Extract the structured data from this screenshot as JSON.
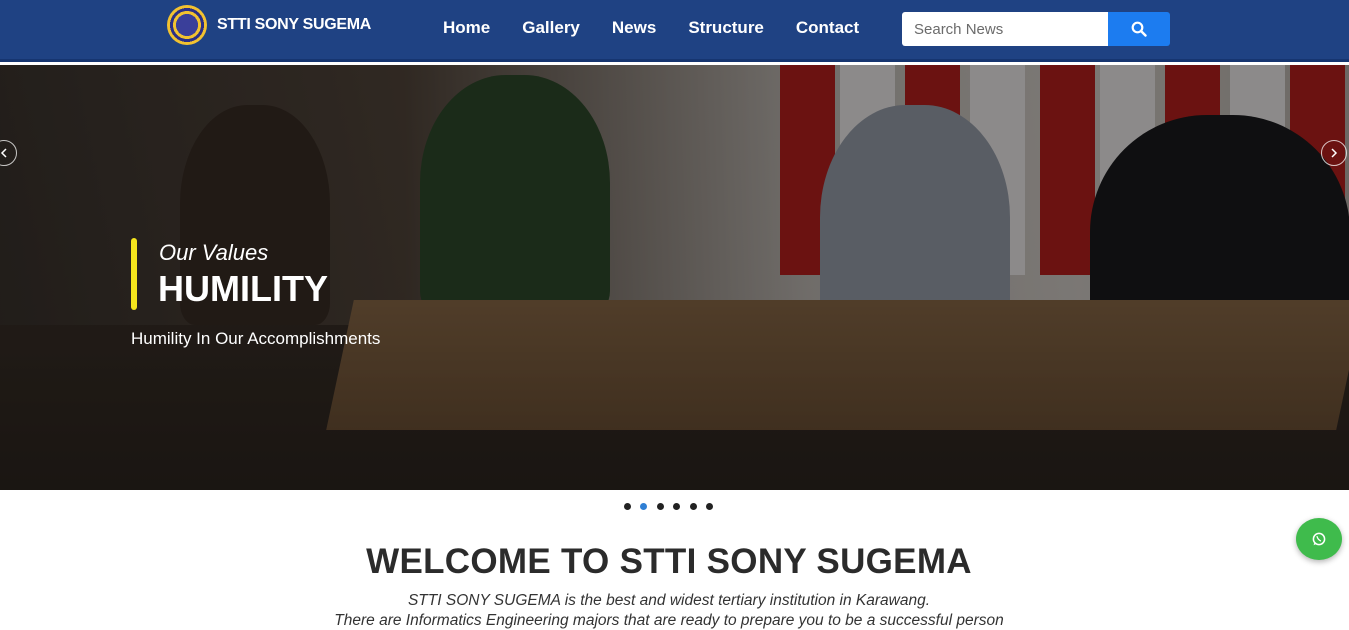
{
  "brand": {
    "name": "STTI SONY SUGEMA"
  },
  "nav": {
    "items": [
      "Home",
      "Gallery",
      "News",
      "Structure",
      "Contact"
    ]
  },
  "search": {
    "placeholder": "Search News",
    "icon": "search-icon"
  },
  "hero": {
    "subtitle": "Our Values",
    "title": "HUMILITY",
    "description": "Humility In Our Accomplishments",
    "slide_count": 6,
    "active_slide": 2
  },
  "welcome": {
    "title": "WELCOME TO STTI SONY SUGEMA",
    "line1": "STTI SONY SUGEMA is the best and widest tertiary institution in Karawang.",
    "line2": "There are Informatics Engineering majors that are ready to prepare you to be a successful person"
  },
  "colors": {
    "navbar": "#1f4283",
    "search_button": "#1c7cf0",
    "accent_bar": "#f5e51d",
    "whatsapp": "#3fbb4c",
    "active_dot": "#2f7fd4"
  },
  "floating": {
    "icon": "whatsapp-icon"
  }
}
